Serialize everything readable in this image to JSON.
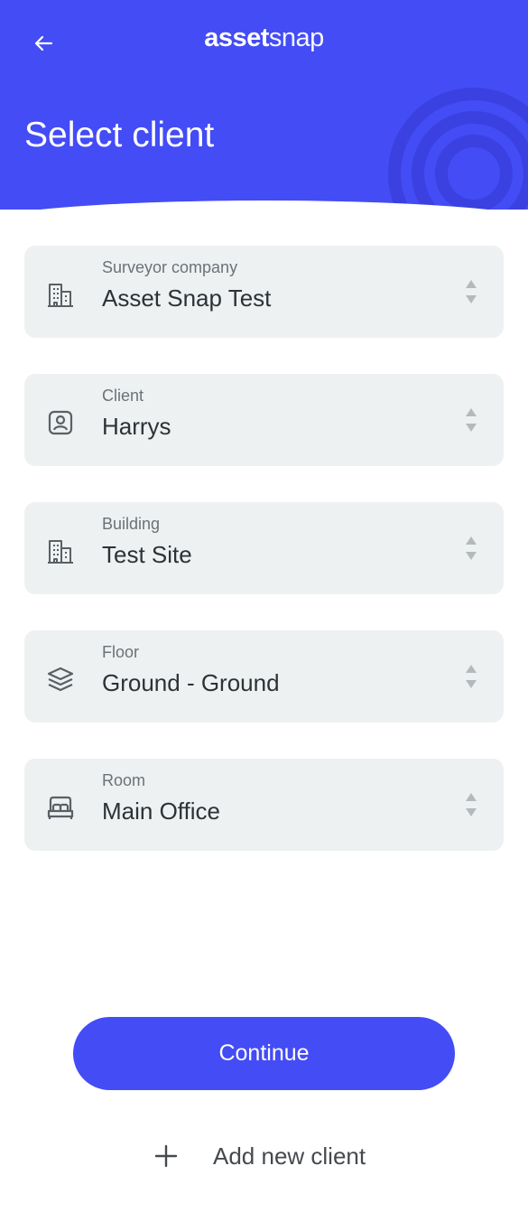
{
  "header": {
    "logo_strong": "asset",
    "logo_light": "snap",
    "title": "Select client",
    "back_icon": "arrow-left-icon"
  },
  "fields": [
    {
      "label": "Surveyor company",
      "value": "Asset Snap Test",
      "icon": "building-icon"
    },
    {
      "label": "Client",
      "value": "Harrys",
      "icon": "contact-card-icon"
    },
    {
      "label": "Building",
      "value": "Test Site",
      "icon": "building-icon"
    },
    {
      "label": "Floor",
      "value": "Ground - Ground",
      "icon": "layers-icon"
    },
    {
      "label": "Room",
      "value": "Main Office",
      "icon": "bed-icon"
    }
  ],
  "actions": {
    "continue_label": "Continue",
    "add_new_label": "Add new client"
  },
  "colors": {
    "primary": "#434cf5",
    "field_bg": "#eef1f2",
    "text_dark": "#2c3236",
    "text_muted": "#6b7276"
  }
}
